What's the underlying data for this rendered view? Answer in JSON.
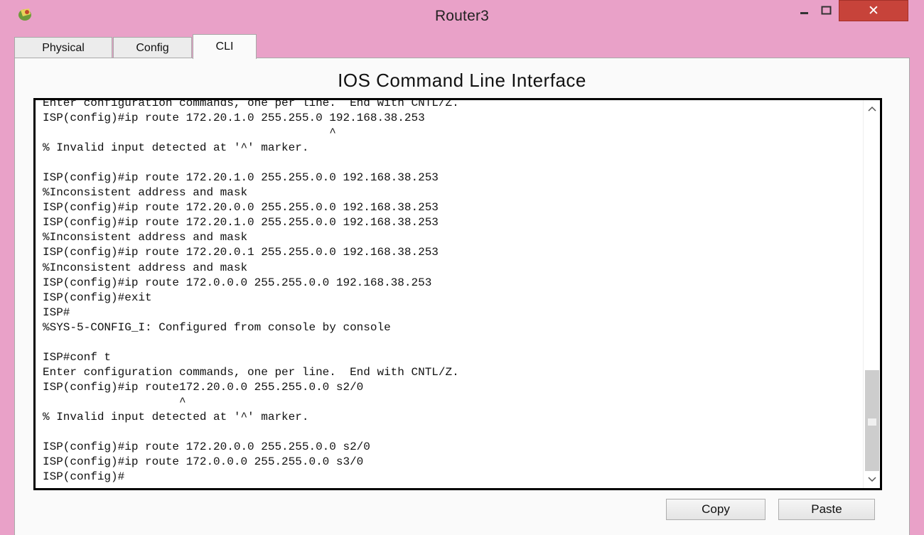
{
  "window": {
    "title": "Router3",
    "controls": {
      "minimize": "–",
      "maximize": "□",
      "close": "✕"
    },
    "icon": "router-app-icon"
  },
  "tabs": [
    {
      "label": "Physical",
      "selected": false
    },
    {
      "label": "Config",
      "selected": false
    },
    {
      "label": "CLI",
      "selected": true
    }
  ],
  "cli": {
    "heading": "IOS Command Line Interface",
    "lines": [
      "Enter configuration commands, one per line.  End with CNTL/Z.",
      "ISP(config)#ip route 172.20.1.0 255.255.0 192.168.38.253",
      "                                          ^",
      "% Invalid input detected at '^' marker.",
      "",
      "ISP(config)#ip route 172.20.1.0 255.255.0.0 192.168.38.253",
      "%Inconsistent address and mask",
      "ISP(config)#ip route 172.20.0.0 255.255.0.0 192.168.38.253",
      "ISP(config)#ip route 172.20.1.0 255.255.0.0 192.168.38.253",
      "%Inconsistent address and mask",
      "ISP(config)#ip route 172.20.0.1 255.255.0.0 192.168.38.253",
      "%Inconsistent address and mask",
      "ISP(config)#ip route 172.0.0.0 255.255.0.0 192.168.38.253",
      "ISP(config)#exit",
      "ISP#",
      "%SYS-5-CONFIG_I: Configured from console by console",
      "",
      "ISP#conf t",
      "Enter configuration commands, one per line.  End with CNTL/Z.",
      "ISP(config)#ip route172.20.0.0 255.255.0.0 s2/0",
      "                    ^",
      "% Invalid input detected at '^' marker.",
      "",
      "ISP(config)#ip route 172.20.0.0 255.255.0.0 s2/0",
      "ISP(config)#ip route 172.0.0.0 255.255.0.0 s3/0",
      "ISP(config)#"
    ]
  },
  "buttons": {
    "copy": "Copy",
    "paste": "Paste"
  },
  "colors": {
    "window_frame": "#e9a1c8",
    "close_button": "#c7433a",
    "terminal_border": "#000000"
  }
}
